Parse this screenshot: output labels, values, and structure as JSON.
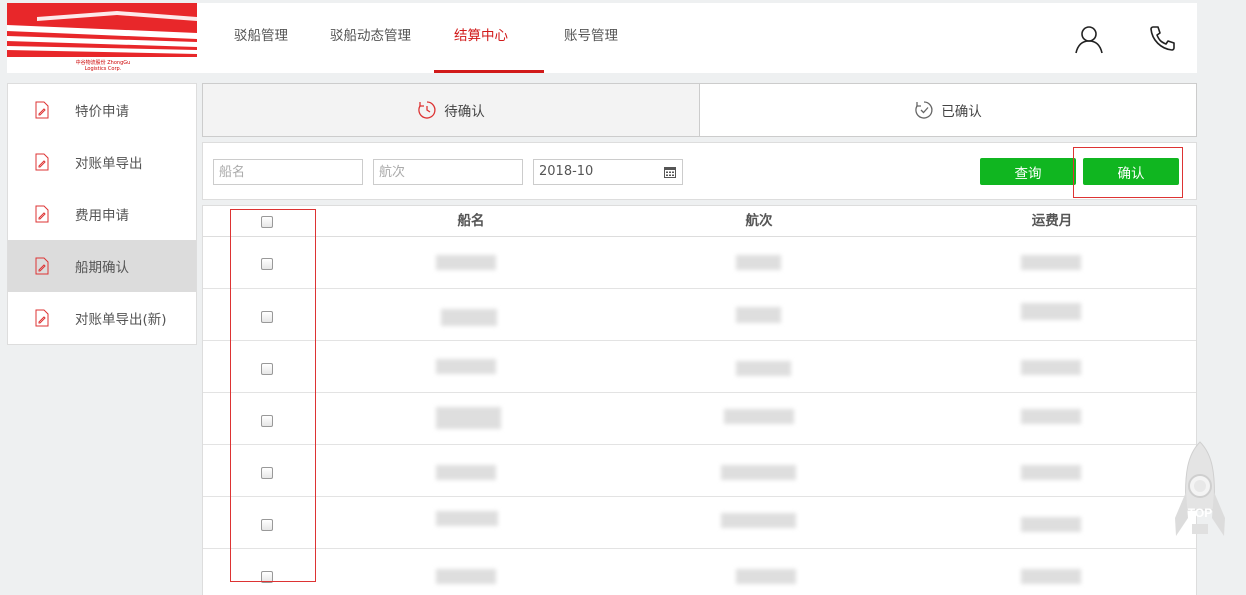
{
  "logo": {
    "caption": "中谷物流股份 ZhongGu Logistics Corp."
  },
  "nav": {
    "items": [
      {
        "label": "驳船管理"
      },
      {
        "label": "驳船动态管理"
      },
      {
        "label": "结算中心"
      },
      {
        "label": "账号管理"
      }
    ],
    "active_index": 2
  },
  "header_icons": {
    "user": "user-icon",
    "phone": "phone-icon"
  },
  "sidebar": {
    "items": [
      {
        "label": "特价申请",
        "icon": "document-edit-icon"
      },
      {
        "label": "对账单导出",
        "icon": "document-edit-icon"
      },
      {
        "label": "费用申请",
        "icon": "document-edit-icon"
      },
      {
        "label": "船期确认",
        "icon": "document-edit-icon"
      },
      {
        "label": "对账单导出(新)",
        "icon": "document-edit-icon"
      }
    ],
    "active_index": 3
  },
  "tabs": [
    {
      "label": "待确认",
      "icon": "clock-icon"
    },
    {
      "label": "已确认",
      "icon": "check-clock-icon"
    }
  ],
  "filter": {
    "ship_name_placeholder": "船名",
    "voyage_placeholder": "航次",
    "month_value": "2018-10",
    "query_label": "查询",
    "confirm_label": "确认"
  },
  "table": {
    "headers": [
      "船名",
      "航次",
      "运费月"
    ],
    "visible_rows": 7
  },
  "back_to_top": {
    "label": "TOP"
  },
  "colors": {
    "accent_red": "#d11a1a",
    "button_green": "#10b620",
    "highlight_red": "#dd3333"
  }
}
